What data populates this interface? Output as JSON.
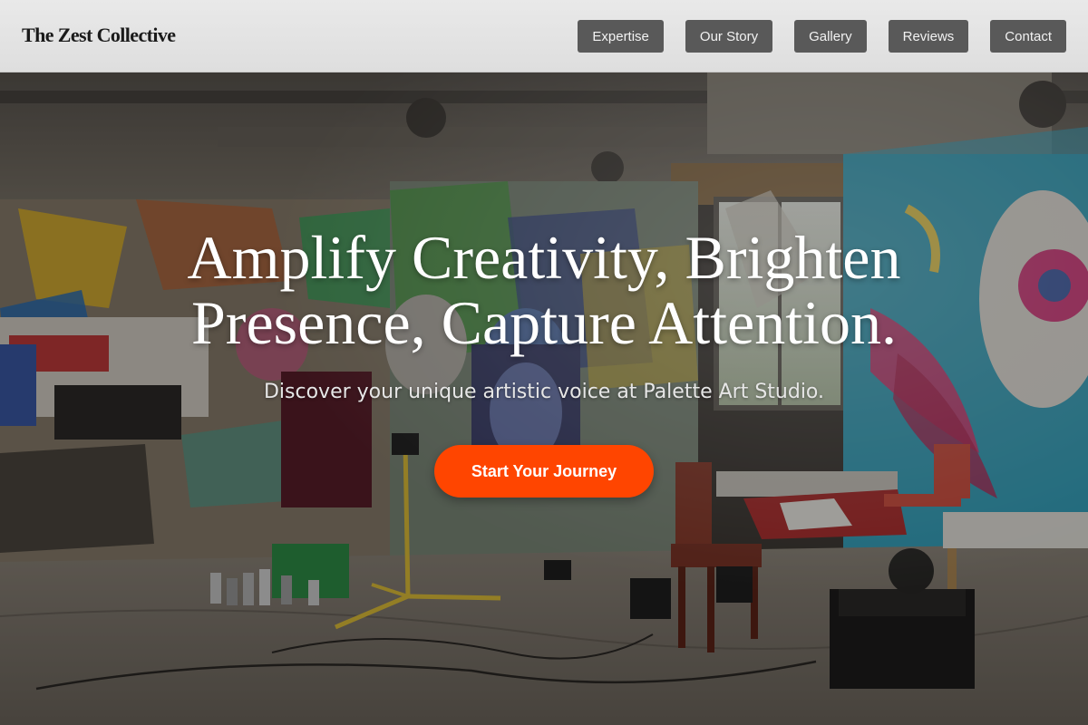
{
  "header": {
    "brand": "The Zest Collective",
    "nav": [
      {
        "label": "Expertise"
      },
      {
        "label": "Our Story"
      },
      {
        "label": "Gallery"
      },
      {
        "label": "Reviews"
      },
      {
        "label": "Contact"
      }
    ]
  },
  "hero": {
    "title": "Amplify Creativity, Brighten Presence, Capture Attention.",
    "subtitle": "Discover your unique artistic voice at Palette Art Studio.",
    "cta_label": "Start Your Journey",
    "background_image": "graffiti-art-studio-photo"
  },
  "colors": {
    "accent": "#ff4500",
    "nav_button_bg": "#595959",
    "header_bg": "#e4e4e4"
  }
}
